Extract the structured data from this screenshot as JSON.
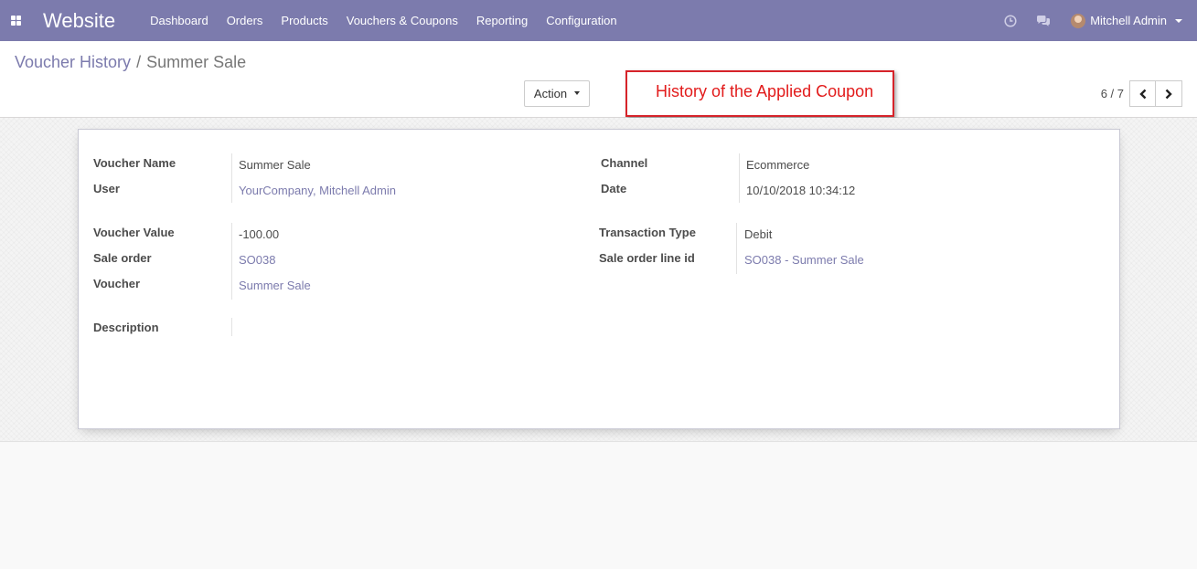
{
  "navbar": {
    "brand": "Website",
    "menu": [
      "Dashboard",
      "Orders",
      "Products",
      "Vouchers & Coupons",
      "Reporting",
      "Configuration"
    ],
    "user_name": "Mitchell Admin",
    "icons": [
      "apps-grid-icon",
      "clock-icon",
      "chat-icon",
      "avatar"
    ]
  },
  "breadcrumb": {
    "parent": "Voucher History",
    "separator": "/",
    "current": "Summer Sale"
  },
  "toolbar": {
    "action_label": "Action"
  },
  "annotation": {
    "text": "History of the Applied Coupon",
    "color": "#e21b1b"
  },
  "pager": {
    "value": "6 / 7"
  },
  "form": {
    "voucher_name_label": "Voucher Name",
    "voucher_name": "Summer Sale",
    "user_label": "User",
    "user": "YourCompany, Mitchell Admin",
    "channel_label": "Channel",
    "channel": "Ecommerce",
    "date_label": "Date",
    "date": "10/10/2018 10:34:12",
    "voucher_value_label": "Voucher Value",
    "voucher_value": "-100.00",
    "sale_order_label": "Sale order",
    "sale_order": "SO038",
    "voucher_label": "Voucher",
    "voucher": "Summer Sale",
    "transaction_type_label": "Transaction Type",
    "transaction_type": "Debit",
    "sale_order_line_label": "Sale order line id",
    "sale_order_line": "SO038 - Summer Sale",
    "description_label": "Description",
    "description": ""
  },
  "colors": {
    "navbar": "#7c7bad",
    "link": "#7c7bad",
    "annotation_border": "#d6232a"
  }
}
